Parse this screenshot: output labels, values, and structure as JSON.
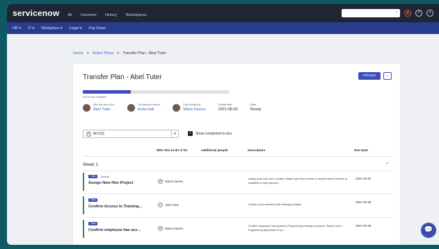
{
  "brand": "servicenow",
  "topnav": [
    "All",
    "Favorites",
    "History",
    "Workspaces"
  ],
  "subnav": [
    "HR ▾",
    "IT ▾",
    "Workplace ▾",
    "Legal ▾",
    "Org Chart"
  ],
  "breadcrumb": {
    "home": "Home",
    "sep1": ">",
    "plans": "Active Plans",
    "sep2": ">",
    "current": "Transfer Plan - Abel Tuter"
  },
  "card": {
    "title": "Transfer Plan - Abel Tuter",
    "edit_label": "Edit plan",
    "more_label": "...",
    "progress": 0.33,
    "progress_label": "4/12 to-dos complete",
    "meta": [
      {
        "label": "Who this plan is for",
        "value": "Abel Tuter"
      },
      {
        "label": "The person's mentor",
        "value": "Anita Hall"
      },
      {
        "label": "Plan created by",
        "value": "Maria Davies"
      },
      {
        "label": "Publish date",
        "value": "2021-08-03"
      },
      {
        "label": "State",
        "value": "Ready"
      }
    ],
    "filter_value": "All (13)",
    "show_completed": "Show completed to-dos",
    "columns": {
      "who": "Who this to-do is for",
      "additional": "Additional people",
      "description": "Description",
      "due": "Due Date"
    },
    "week": "Week 1",
    "rows": [
      {
        "tag": "Todo",
        "optional": "Optional",
        "name": "Assign New Hire Project",
        "who": "Maria Davies",
        "initials": "MD",
        "desc": "Assign your new hire a project. Make sure their mentor or another team member is available to help support...",
        "due": "2021-09-02"
      },
      {
        "tag": "Todo",
        "optional": "",
        "name": "Confirm Access to Training...",
        "who": "Abel Tuter",
        "initials": "AT",
        "desc": "Confirm your access to the training modules",
        "due": "2021-09-06"
      },
      {
        "tag": "Todo",
        "optional": "",
        "name": "Confirm employee has acc...",
        "who": "Maria Davies",
        "initials": "MD",
        "desc": "Confirm employee has access to Engineering training resources. Reach out to Engineering department if yo...",
        "due": "2021-09-06"
      }
    ]
  },
  "colors": {
    "topbar": "#1e2533",
    "subnav": "#283c8e",
    "accent": "#3b4db7",
    "row_border": "#2a8a62"
  }
}
